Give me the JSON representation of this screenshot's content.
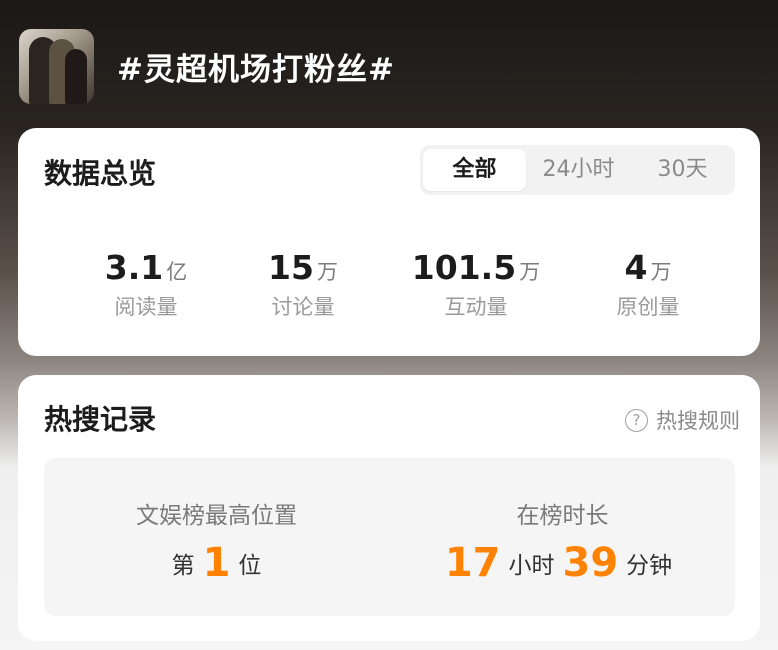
{
  "header": {
    "topic": "#灵超机场打粉丝#"
  },
  "overview": {
    "title": "数据总览",
    "tabs": [
      {
        "label": "全部",
        "active": true
      },
      {
        "label": "24小时",
        "active": false
      },
      {
        "label": "30天",
        "active": false
      }
    ],
    "stats": [
      {
        "value": "3.1",
        "unit": "亿",
        "label": "阅读量"
      },
      {
        "value": "15",
        "unit": "万",
        "label": "讨论量"
      },
      {
        "value": "101.5",
        "unit": "万",
        "label": "互动量"
      },
      {
        "value": "4",
        "unit": "万",
        "label": "原创量"
      }
    ]
  },
  "hot_search": {
    "title": "热搜记录",
    "rules_label": "热搜规则",
    "rules_icon": "question-circle-icon",
    "peak": {
      "heading": "文娱榜最高位置",
      "prefix": "第",
      "value": "1",
      "suffix": "位"
    },
    "duration": {
      "heading": "在榜时长",
      "hours": "17",
      "hours_unit": "小时",
      "minutes": "39",
      "minutes_unit": "分钟"
    }
  },
  "colors": {
    "accent": "#ff8200",
    "card": "#ffffff",
    "muted_text": "#9a9a9a"
  }
}
